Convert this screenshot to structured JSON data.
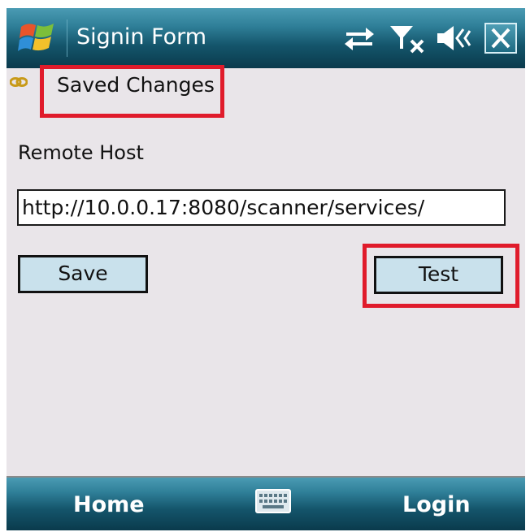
{
  "title_bar": {
    "title": "Signin Form",
    "icons": [
      "windows-start-icon",
      "sync-arrows-icon",
      "no-signal-icon",
      "volume-icon"
    ],
    "close_label": "✕"
  },
  "content": {
    "saved_status": "Saved Changes",
    "status_icon": "chain-link-icon",
    "remote_host_label": "Remote Host",
    "remote_host_value": "http://10.0.0.17:8080/scanner/services/",
    "save_button": "Save",
    "test_button": "Test"
  },
  "soft_keys": {
    "left": "Home",
    "center_icon": "keyboard-icon",
    "right": "Login"
  },
  "colors": {
    "highlight": "#e01b2b",
    "button_fill": "#c9e1ec",
    "bar_teal": "#14556b",
    "background": "#e9e5e9"
  }
}
